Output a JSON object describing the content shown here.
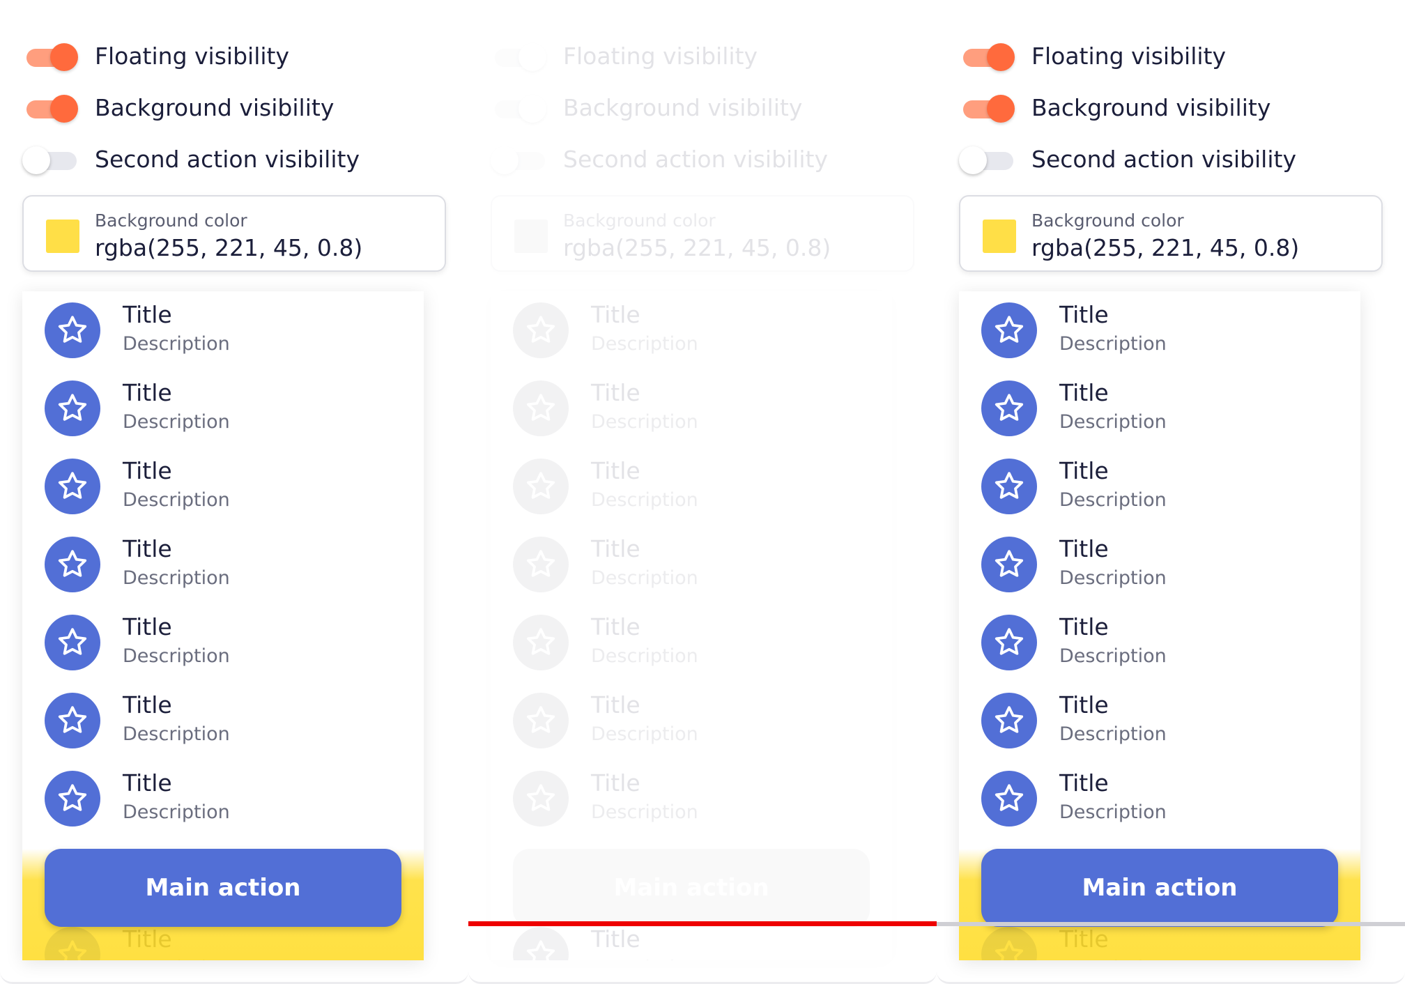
{
  "colors": {
    "accent": "#526fd6",
    "toggle_on": "#ff6a3d",
    "swatch": "#ffdf47",
    "indicator_red": "#ee0000"
  },
  "toggles": [
    {
      "label": "Floating visibility",
      "state": "on"
    },
    {
      "label": "Background visibility",
      "state": "on"
    },
    {
      "label": "Second action visibility",
      "state": "off"
    }
  ],
  "background_color": {
    "label": "Background color",
    "value": "rgba(255, 221, 45, 0.8)"
  },
  "list_item": {
    "title": "Title",
    "description": "Description",
    "icon": "star-icon"
  },
  "main_action": {
    "label": "Main action"
  },
  "panels": [
    {
      "state": "enabled"
    },
    {
      "state": "disabled"
    },
    {
      "state": "enabled"
    }
  ]
}
